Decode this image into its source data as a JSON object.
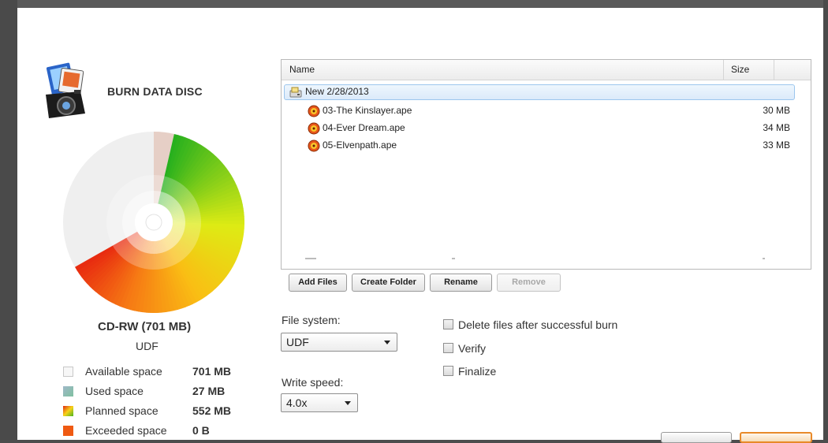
{
  "panel": {
    "title": "BURN DATA DISC",
    "disc_name": "CD-RW (701 MB)",
    "disc_fs": "UDF",
    "app_icon": "camera-media-icon"
  },
  "legend": [
    {
      "label": "Available space",
      "value": "701 MB",
      "color": "#f4f4f4"
    },
    {
      "label": "Used space",
      "value": "27 MB",
      "color": "#7fb7a0"
    },
    {
      "label": "Planned space",
      "value": "552 MB",
      "color": "#f0a020"
    },
    {
      "label": "Exceeded space",
      "value": "0 B",
      "color": "#f05a10"
    }
  ],
  "filelist": {
    "col_name": "Name",
    "col_size": "Size",
    "rows": [
      {
        "name": "New 2/28/2013",
        "size": "",
        "icon": "disc-folder-icon",
        "selected": true
      },
      {
        "name": "03-The Kinslayer.ape",
        "size": "30 MB",
        "icon": "audio-file-icon"
      },
      {
        "name": "04-Ever Dream.ape",
        "size": "34 MB",
        "icon": "audio-file-icon"
      },
      {
        "name": "05-Elvenpath.ape",
        "size": "33 MB",
        "icon": "audio-file-icon"
      }
    ]
  },
  "buttons": {
    "add_files": "Add Files",
    "create_folder": "Create Folder",
    "rename": "Rename",
    "remove": "Remove"
  },
  "options": {
    "file_system_label": "File system:",
    "file_system_value": "UDF",
    "write_speed_label": "Write speed:",
    "write_speed_value": "4.0x",
    "delete_files": "Delete files after successful burn",
    "verify": "Verify",
    "finalize": "Finalize"
  }
}
